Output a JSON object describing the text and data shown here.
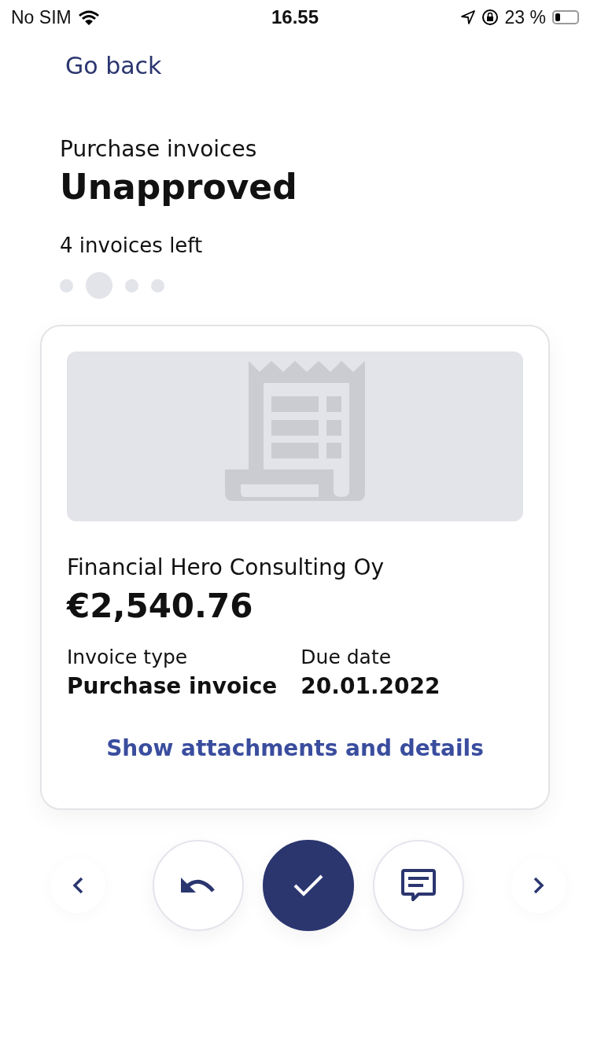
{
  "status_bar": {
    "carrier": "No SIM",
    "time": "16.55",
    "battery_percent": "23 %",
    "battery": {
      "level": 0.23
    }
  },
  "back_link": "Go back",
  "header": {
    "subtitle": "Purchase invoices",
    "title": "Unapproved",
    "counter": "4 invoices left"
  },
  "pager_dots": [
    {
      "selected": false
    },
    {
      "selected": true
    },
    {
      "selected": false
    },
    {
      "selected": false
    }
  ],
  "invoice_card": {
    "supplier": "Financial Hero Consulting Oy",
    "amount": "€2,540.76",
    "fields": [
      {
        "label": "Invoice type",
        "value": "Purchase invoice"
      },
      {
        "label": "Due date",
        "value": "20.01.2022"
      }
    ],
    "details_link": "Show attachments and details"
  },
  "actions": [
    {
      "kind": "previous"
    },
    {
      "kind": "undo"
    },
    {
      "kind": "approve"
    },
    {
      "kind": "comment"
    },
    {
      "kind": "next"
    }
  ]
}
